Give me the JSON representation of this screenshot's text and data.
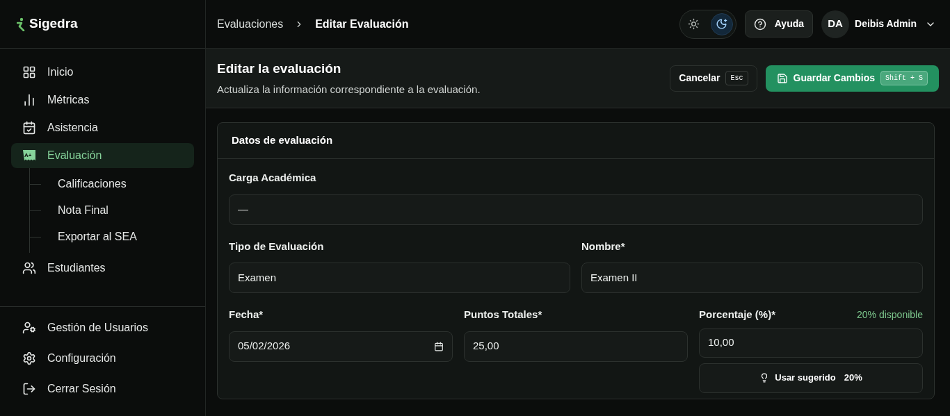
{
  "brand": {
    "name": "Sigedra"
  },
  "sidebar": {
    "items": [
      {
        "kind": "grid",
        "label": "Inicio",
        "selected": false
      },
      {
        "kind": "chart",
        "label": "Métricas",
        "selected": false
      },
      {
        "kind": "calendar",
        "label": "Asistencia",
        "selected": false
      },
      {
        "kind": "grade",
        "icon_text": "A+",
        "label": "Evaluación",
        "selected": true,
        "children": [
          {
            "label": "Calificaciones"
          },
          {
            "label": "Nota Final"
          },
          {
            "label": "Exportar al SEA"
          }
        ]
      },
      {
        "kind": "users",
        "label": "Estudiantes",
        "selected": false
      }
    ],
    "bottom": [
      {
        "kind": "usergear",
        "label": "Gestión de Usuarios"
      },
      {
        "kind": "gear",
        "label": "Configuración"
      },
      {
        "kind": "logout",
        "label": "Cerrar Sesión"
      }
    ]
  },
  "breadcrumb": [
    "Evaluaciones",
    "Editar Evaluación"
  ],
  "theme_toggle": [
    {
      "kind": "sun",
      "selected": false
    },
    {
      "kind": "moon",
      "selected": true
    }
  ],
  "help": {
    "label": "Ayuda"
  },
  "user": {
    "initials": "DA",
    "name": "Deibis Admin"
  },
  "page": {
    "title": "Editar la evaluación",
    "subtitle": "Actualiza la información correspondiente a la evaluación.",
    "cancel": {
      "label": "Cancelar",
      "shortcut": "Esc"
    },
    "save": {
      "label": "Guardar Cambios",
      "shortcut": "Shift + S"
    }
  },
  "card": {
    "title": "Datos de evaluación",
    "carga": {
      "label": "Carga Académica",
      "value": "—"
    },
    "tipo": {
      "label": "Tipo de Evaluación",
      "value": "Examen"
    },
    "nombre": {
      "label": "Nombre*",
      "value": "Examen II"
    },
    "fecha": {
      "label": "Fecha*",
      "value": "05/02/2026"
    },
    "puntos": {
      "label": "Puntos Totales*",
      "value": "25,00"
    },
    "porcentaje": {
      "label": "Porcentaje (%)*",
      "hint": "20% disponible",
      "value": "10,00"
    },
    "suggest": {
      "label": "Usar sugerido",
      "value": "20%"
    }
  }
}
